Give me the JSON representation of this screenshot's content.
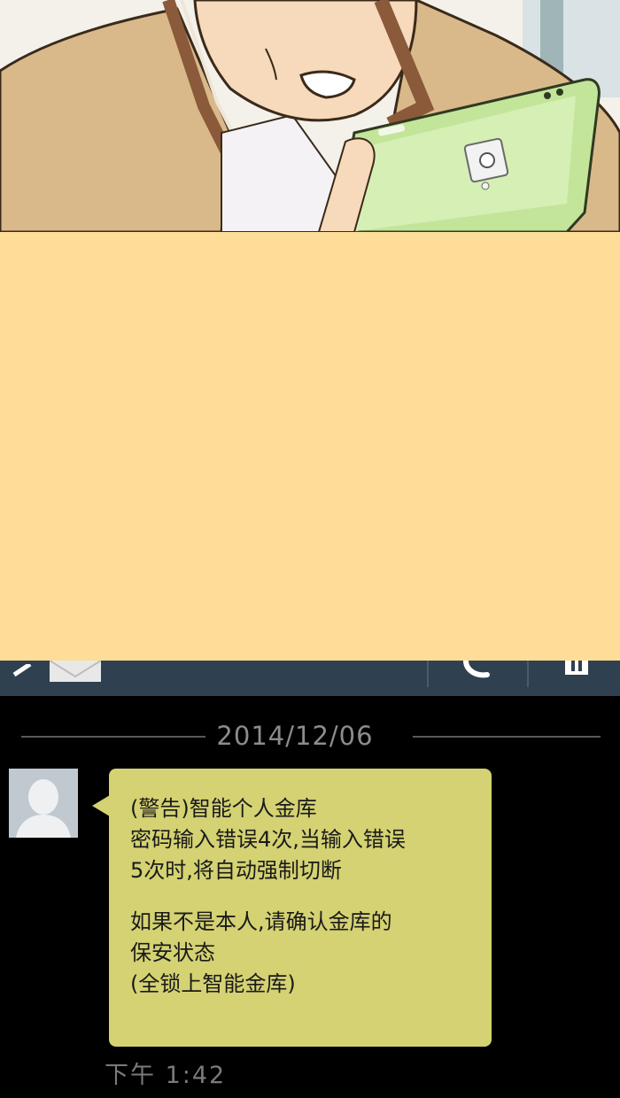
{
  "message": {
    "date": "2014/12/06",
    "lines": [
      "(警告)智能个人金库",
      "密码输入错误4次,当输入错误",
      "5次时,将自动强制切断",
      "如果不是本人,请确认金库的",
      "保安状态",
      "(全锁上智能金库)"
    ],
    "time": "下午  1:42"
  },
  "colors": {
    "panel": "#fddd98",
    "action_bar": "#2f4150",
    "bubble": "#d4d272",
    "phone_green": "#c3e59a"
  },
  "icons": {
    "back": "back-icon",
    "mail": "mail-icon",
    "call": "call-icon",
    "delete": "trash-icon"
  }
}
